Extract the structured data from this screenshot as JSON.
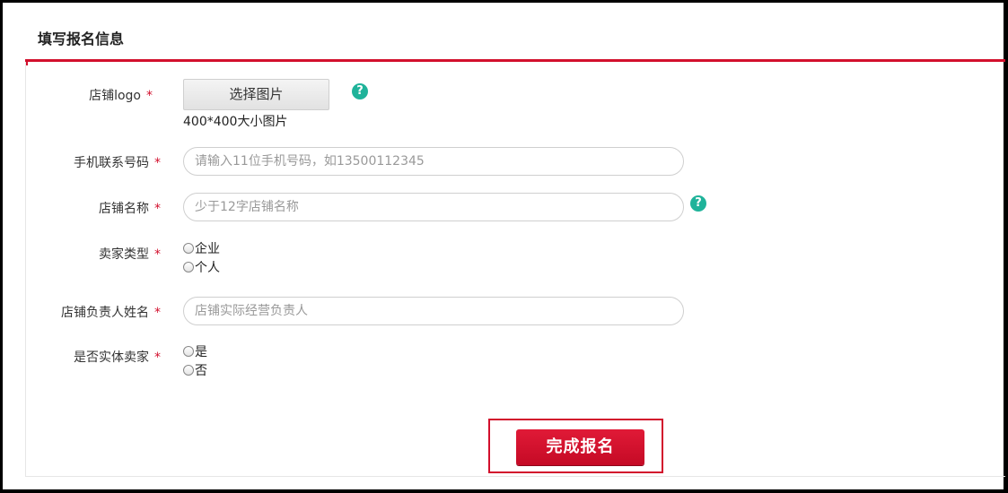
{
  "form": {
    "title": "填写报名信息",
    "required_mark": "*",
    "logo": {
      "label": "店铺logo",
      "button_label": "选择图片",
      "hint": "400*400大小图片",
      "help_icon": "question-icon"
    },
    "phone": {
      "label": "手机联系号码",
      "placeholder": "请输入11位手机号码，如13500112345",
      "value": ""
    },
    "shop_name": {
      "label": "店铺名称",
      "placeholder": "少于12字店铺名称",
      "value": "",
      "help_icon": "question-icon"
    },
    "seller_type": {
      "label": "卖家类型",
      "options": [
        "企业",
        "个人"
      ]
    },
    "manager_name": {
      "label": "店铺负责人姓名",
      "placeholder": "店铺实际经营负责人",
      "value": ""
    },
    "physical_seller": {
      "label": "是否实体卖家",
      "options": [
        "是",
        "否"
      ]
    },
    "submit_label": "完成报名"
  },
  "colors": {
    "accent": "#d20f2c",
    "help": "#1fb39a"
  }
}
